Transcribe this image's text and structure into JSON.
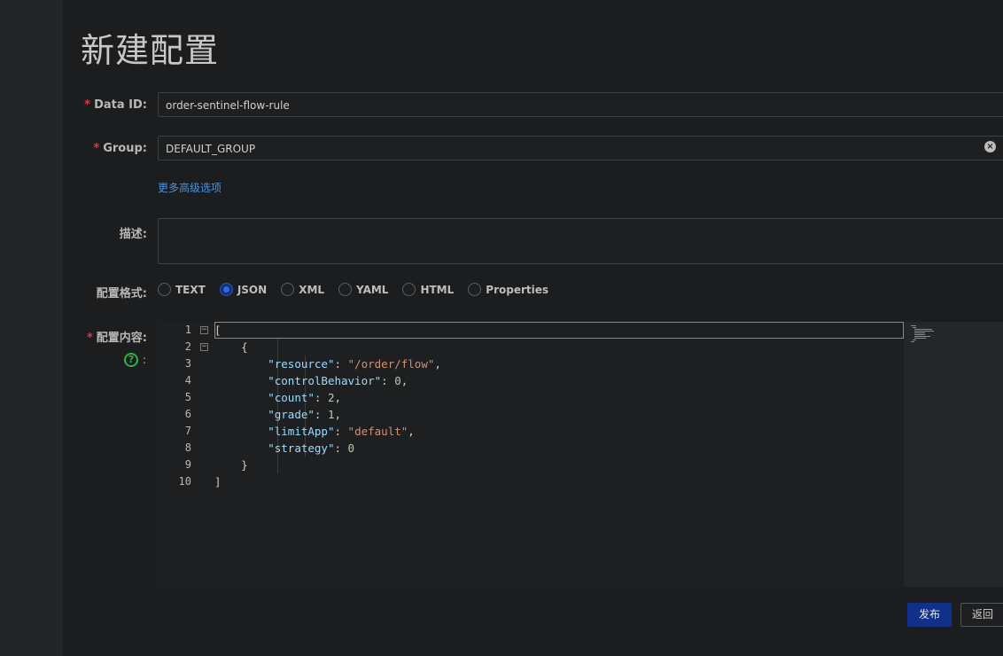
{
  "page": {
    "title": "新建配置"
  },
  "form": {
    "data_id": {
      "label": "Data ID:",
      "value": "order-sentinel-flow-rule"
    },
    "group": {
      "label": "Group:",
      "value": "DEFAULT_GROUP"
    },
    "advanced_link": "更多高级选项",
    "description": {
      "label": "描述:",
      "value": ""
    },
    "format": {
      "label": "配置格式:",
      "options": [
        "TEXT",
        "JSON",
        "XML",
        "YAML",
        "HTML",
        "Properties"
      ],
      "selected": "JSON"
    },
    "content": {
      "label": "配置内容:",
      "help_colon": ":"
    }
  },
  "editor": {
    "lines": [
      {
        "num": "1",
        "fold": "−"
      },
      {
        "num": "2",
        "fold": "−"
      },
      {
        "num": "3"
      },
      {
        "num": "4"
      },
      {
        "num": "5"
      },
      {
        "num": "6"
      },
      {
        "num": "7"
      },
      {
        "num": "8"
      },
      {
        "num": "9"
      },
      {
        "num": "10"
      }
    ],
    "code": [
      {
        "t": "["
      },
      {
        "t": "    {"
      },
      {
        "key": "\"resource\"",
        "val": "\"/order/flow\"",
        "vtype": "s",
        "tail": ","
      },
      {
        "key": "\"controlBehavior\"",
        "val": "0",
        "vtype": "n",
        "tail": ","
      },
      {
        "key": "\"count\"",
        "val": "2",
        "vtype": "n",
        "tail": ","
      },
      {
        "key": "\"grade\"",
        "val": "1",
        "vtype": "n",
        "tail": ","
      },
      {
        "key": "\"limitApp\"",
        "val": "\"default\"",
        "vtype": "s",
        "tail": ","
      },
      {
        "key": "\"strategy\"",
        "val": "0",
        "vtype": "n",
        "tail": ""
      },
      {
        "t": "    }"
      },
      {
        "t": "]"
      }
    ]
  },
  "buttons": {
    "publish": "发布",
    "back": "返回"
  },
  "icons": {
    "clear": "clear-icon",
    "help": "help-icon"
  },
  "colors": {
    "accent": "#11308a",
    "link": "#4a93d8",
    "required": "#e4393c",
    "help": "#2fb14a"
  }
}
